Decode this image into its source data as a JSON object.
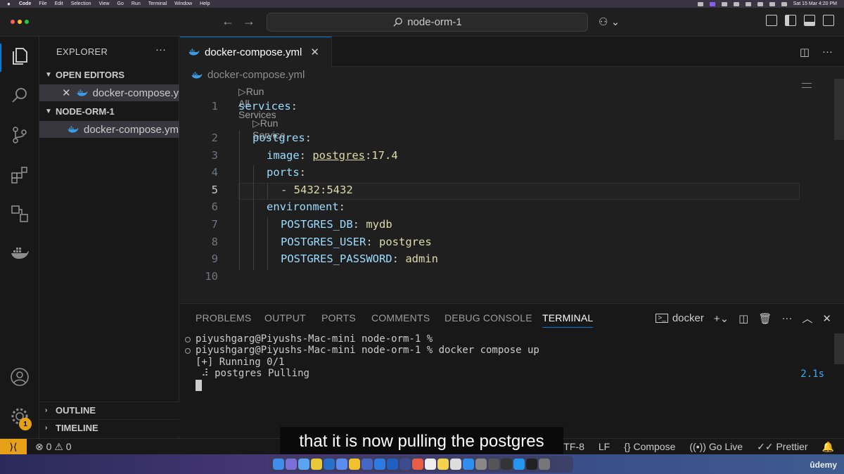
{
  "menubar": {
    "items": [
      "Code",
      "File",
      "Edit",
      "Selection",
      "View",
      "Go",
      "Run",
      "Terminal",
      "Window",
      "Help"
    ],
    "datetime": "Sat 15 Mar  4:20 PM"
  },
  "titlebar": {
    "search_text": "node-orm-1"
  },
  "explorer": {
    "title": "EXPLORER",
    "open_editors_label": "OPEN EDITORS",
    "open_editor_file": "docker-compose.yml",
    "project_label": "NODE-ORM-1",
    "project_file": "docker-compose.yml",
    "outline_label": "OUTLINE",
    "timeline_label": "TIMELINE"
  },
  "editor": {
    "tab_label": "docker-compose.yml",
    "breadcrumb": "docker-compose.yml",
    "codelens_all": "Run All Services",
    "codelens_service": "Run Service",
    "current_line": 5,
    "lines": [
      {
        "num": "1",
        "indent": 0,
        "key": "services",
        "sep": ":",
        "val": ""
      },
      {
        "num": "2",
        "indent": 1,
        "key": "postgres",
        "sep": ":",
        "val": ""
      },
      {
        "num": "3",
        "indent": 2,
        "key": "image",
        "sep": ": ",
        "val_ul": "postgres",
        "val": ":17.4"
      },
      {
        "num": "4",
        "indent": 2,
        "key": "ports",
        "sep": ":",
        "val": ""
      },
      {
        "num": "5",
        "indent": 3,
        "key": "- ",
        "sep": "",
        "val": "5432:5432"
      },
      {
        "num": "6",
        "indent": 2,
        "key": "environment",
        "sep": ":",
        "val": ""
      },
      {
        "num": "7",
        "indent": 3,
        "key": "POSTGRES_DB",
        "sep": ": ",
        "val": "mydb"
      },
      {
        "num": "8",
        "indent": 3,
        "key": "POSTGRES_USER",
        "sep": ": ",
        "val": "postgres"
      },
      {
        "num": "9",
        "indent": 3,
        "key": "POSTGRES_PASSWORD",
        "sep": ": ",
        "val": "admin"
      },
      {
        "num": "10",
        "indent": 0,
        "key": "",
        "sep": "",
        "val": ""
      }
    ]
  },
  "panel": {
    "tabs": [
      "PROBLEMS",
      "OUTPUT",
      "PORTS",
      "COMMENTS",
      "DEBUG CONSOLE",
      "TERMINAL"
    ],
    "active_tab": "TERMINAL",
    "terminal_name": "docker",
    "terminal_lines": [
      "piyushgarg@Piyushs-Mac-mini node-orm-1 %",
      "piyushgarg@Piyushs-Mac-mini node-orm-1 % docker compose up",
      "[+] Running 0/1",
      " ⠼ postgres Pulling"
    ],
    "elapsed": "2.1s"
  },
  "statusbar": {
    "errors": "0",
    "warnings": "0",
    "encoding": "UTF-8",
    "eol": "LF",
    "compose": "Compose",
    "golive": "Go Live",
    "prettier": "Prettier"
  },
  "activity_badge": "1",
  "caption": "that it is now pulling the postgres",
  "watermark": "ûdemy",
  "colors": {
    "accent": "#0078d4",
    "remote": "#e6a117",
    "yaml_key": "#9cdcfe",
    "yaml_value": "#dcdcaa"
  }
}
